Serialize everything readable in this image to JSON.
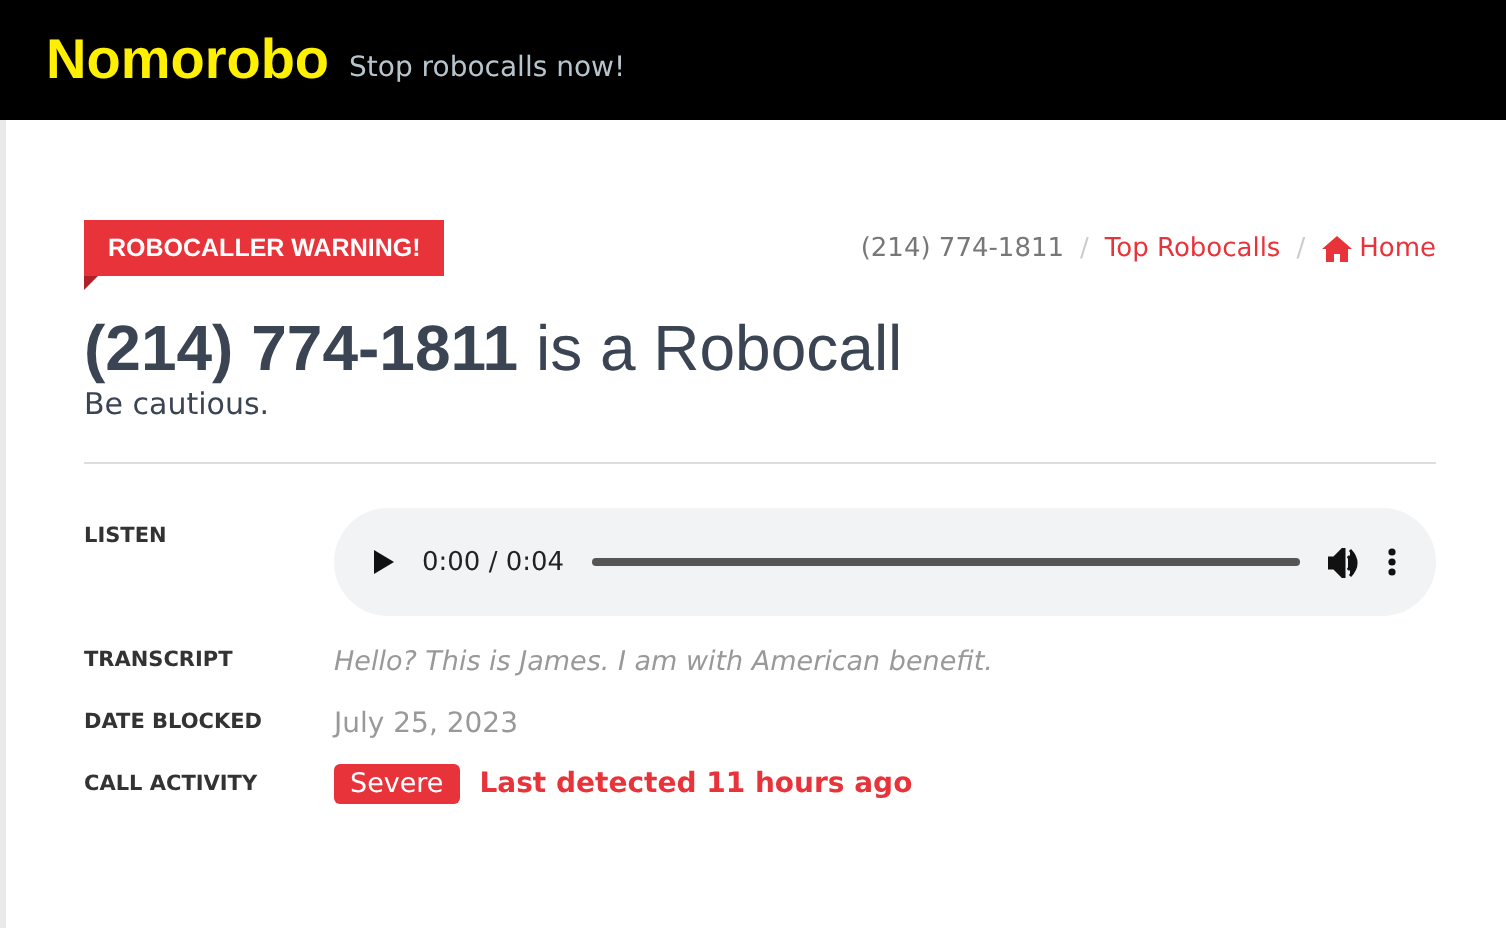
{
  "header": {
    "logo": "Nomorobo",
    "tagline": "Stop robocalls now!"
  },
  "badge": "ROBOCALLER WARNING!",
  "breadcrumb": [
    {
      "label": "(214) 774-1811",
      "kind": "current"
    },
    {
      "label": "/",
      "kind": "separator"
    },
    {
      "label": "Top Robocalls",
      "kind": "link"
    },
    {
      "label": "/",
      "kind": "separator"
    },
    {
      "label": "Home",
      "kind": "home"
    }
  ],
  "headline": {
    "number": "(214) 774-1811",
    "rest": "is a Robocall"
  },
  "subtitle": "Be cautious.",
  "details": [
    {
      "label": "LISTEN",
      "kind": "audio",
      "time": "0:00 / 0:04",
      "level": 0
    },
    {
      "label": "TRANSCRIPT",
      "kind": "transcript",
      "value": "Hello? This is James. I am with American benefit."
    },
    {
      "label": "DATE BLOCKED",
      "kind": "date",
      "value": "July 25, 2023"
    },
    {
      "label": "CALL ACTIVITY",
      "kind": "activity",
      "tag": "Severe",
      "value": "Last detected 11 hours ago"
    }
  ]
}
